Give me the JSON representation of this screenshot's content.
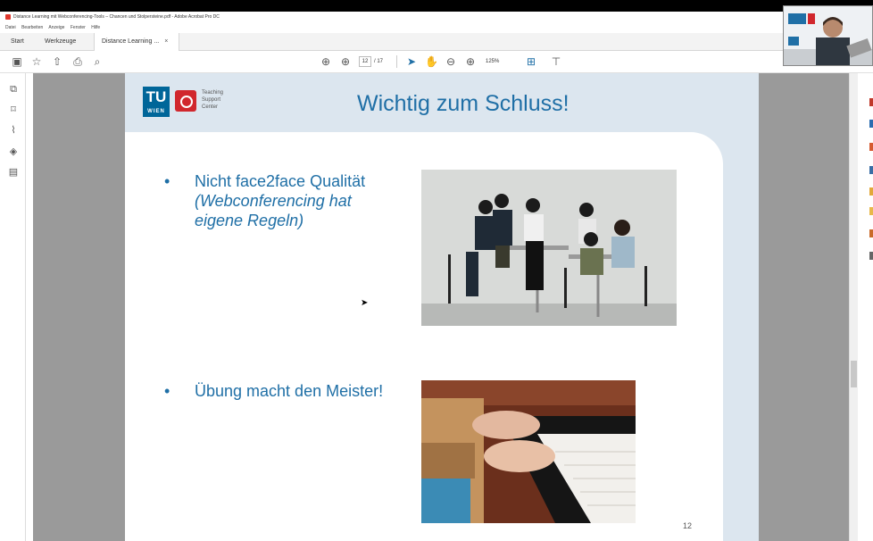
{
  "window": {
    "title": "Distance Learning mit Webconferencing-Tools – Chancen und Stolpersteine.pdf - Adobe Acrobat Pro DC"
  },
  "menu": [
    "Datei",
    "Bearbeiten",
    "Anzeige",
    "Fenster",
    "Hilfe"
  ],
  "tabs": [
    {
      "label": "Start"
    },
    {
      "label": "Werkzeuge"
    },
    {
      "label": "Distance Learning ...",
      "close": "×"
    }
  ],
  "toolbar": {
    "page_current": "12",
    "page_total": "/ 17",
    "zoom": "125%"
  },
  "slide": {
    "logo_tu_top": "TU",
    "logo_tu_bottom": "WIEN",
    "logo_lines": [
      "Teaching",
      "Support",
      "Center"
    ],
    "title": "Wichtig zum Schluss!",
    "bullet1_line1": "Nicht face2face Qualität",
    "bullet1_line2": "(Webconferencing hat",
    "bullet1_line3": "eigene Regeln)",
    "bullet2": "Übung macht den Meister!",
    "bullet_marker": "•",
    "page_number": "12"
  },
  "colors": {
    "accent": "#1f6fa6",
    "tu_blue": "#006699",
    "tsc_red": "#d1272d"
  }
}
